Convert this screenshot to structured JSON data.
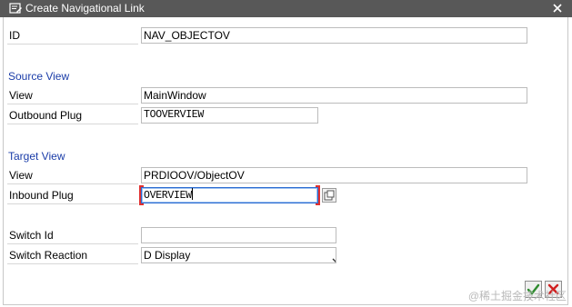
{
  "window": {
    "title": "Create Navigational Link",
    "close_icon": "close-icon"
  },
  "id_row": {
    "label": "ID",
    "value": "NAV_OBJECTOV"
  },
  "source_view": {
    "section_title": "Source View",
    "view_label": "View",
    "view_value": "MainWindow",
    "plug_label": "Outbound Plug",
    "plug_value": "TOOVERVIEW"
  },
  "target_view": {
    "section_title": "Target View",
    "view_label": "View",
    "view_value": "PRDIOOV/ObjectOV",
    "plug_label": "Inbound Plug",
    "plug_value": "OVERVIEW"
  },
  "switch": {
    "id_label": "Switch Id",
    "id_value": "",
    "reaction_label": "Switch Reaction",
    "reaction_value": "D Display"
  },
  "footer": {
    "ok_icon": "checkmark-icon",
    "cancel_icon": "cancel-x-icon",
    "watermark": "@稀土掘金技术社区"
  },
  "colors": {
    "titlebar": "#585858",
    "section_title": "#1a3ca8",
    "ok_green": "#2e8b2e",
    "cancel_red": "#d02020",
    "focus_bracket": "#e03030"
  }
}
